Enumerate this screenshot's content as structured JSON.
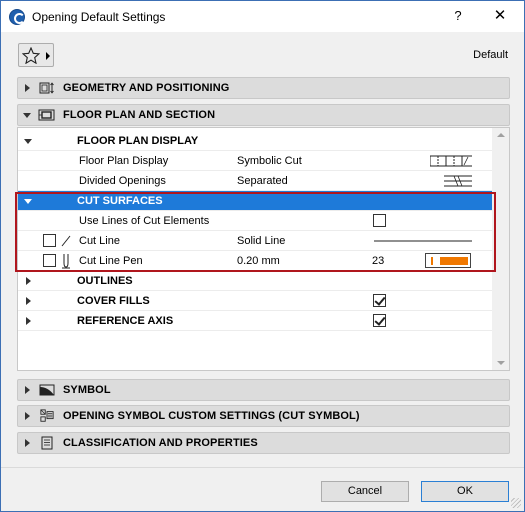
{
  "window": {
    "title": "Opening Default Settings",
    "help_label": "?",
    "close_label": "✕"
  },
  "toolbar": {
    "favorites_icon": "star-icon",
    "default_label": "Default"
  },
  "panels": {
    "geometry": "GEOMETRY AND POSITIONING",
    "floor_plan": "FLOOR PLAN AND SECTION",
    "symbol": "SYMBOL",
    "opening_symbol": "OPENING SYMBOL CUSTOM SETTINGS (CUT SYMBOL)",
    "classification": "CLASSIFICATION AND PROPERTIES"
  },
  "tree": {
    "floor_plan_display_section": "FLOOR PLAN DISPLAY",
    "floor_plan_display": {
      "name": "Floor Plan Display",
      "value": "Symbolic Cut"
    },
    "divided_openings": {
      "name": "Divided Openings",
      "value": "Separated"
    },
    "cut_surfaces_section": "CUT SURFACES",
    "use_lines": {
      "name": "Use Lines of Cut Elements",
      "checked": false
    },
    "cut_line": {
      "name": "Cut Line",
      "value": "Solid Line"
    },
    "cut_line_pen": {
      "name": "Cut Line Pen",
      "value": "0.20 mm",
      "pen_number": "23",
      "pen_color": "#f07800"
    },
    "outlines": "OUTLINES",
    "cover_fills": {
      "name": "COVER FILLS",
      "checked": true
    },
    "reference_axis": {
      "name": "REFERENCE AXIS",
      "checked": true
    }
  },
  "buttons": {
    "cancel": "Cancel",
    "ok": "OK"
  },
  "colors": {
    "selection": "#1e7ad9",
    "highlight_frame": "#b0161d",
    "ok_border": "#2a7fd4"
  }
}
